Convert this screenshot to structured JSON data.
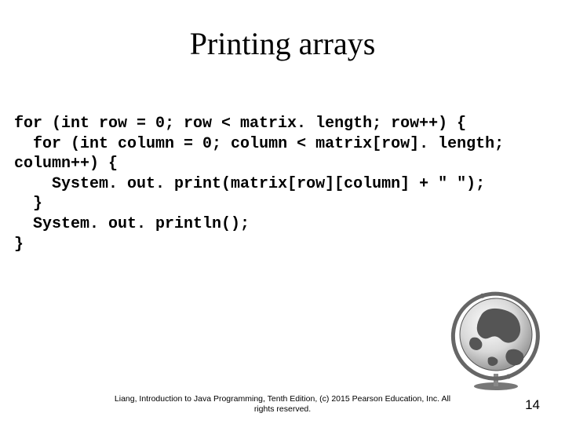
{
  "title": "Printing arrays",
  "code": "for (int row = 0; row < matrix. length; row++) {\n  for (int column = 0; column < matrix[row]. length; column++) {\n    System. out. print(matrix[row][column] + \" \");\n  }\n  System. out. println();\n}",
  "footer_line1": "Liang, Introduction to Java Programming, Tenth Edition, (c) 2015 Pearson Education, Inc. All",
  "footer_line2": "rights reserved.",
  "page_number": "14"
}
